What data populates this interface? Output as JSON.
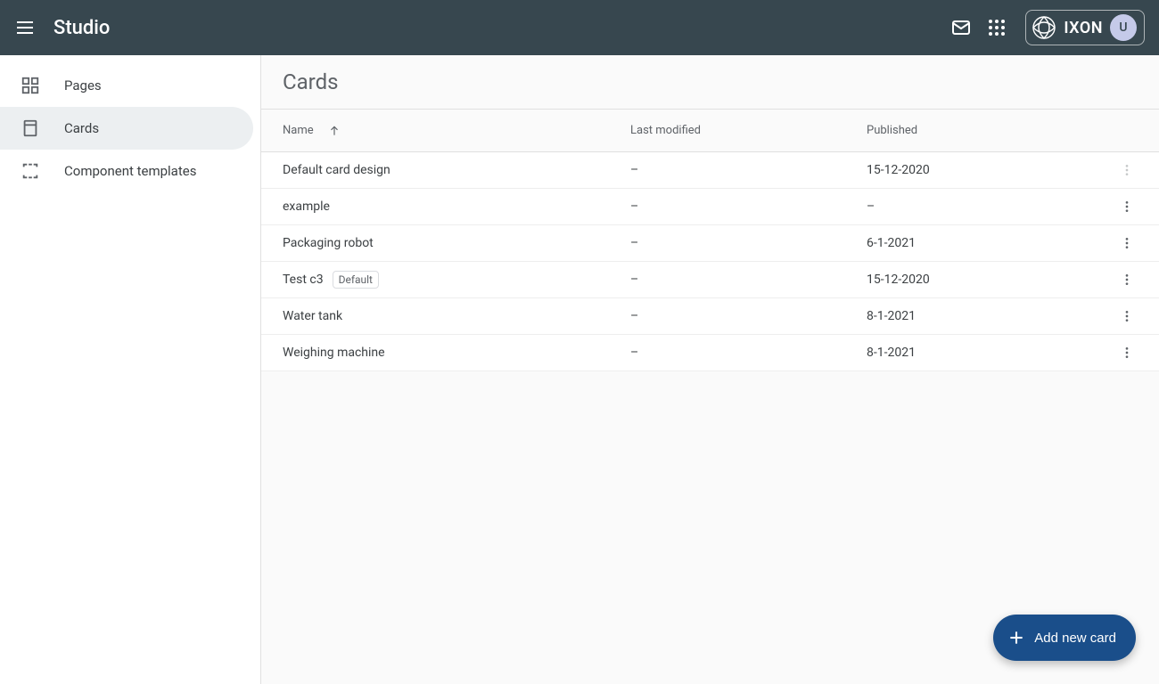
{
  "header": {
    "title": "Studio",
    "brand": "IXON",
    "avatar_initial": "U"
  },
  "sidebar": {
    "items": [
      {
        "label": "Pages",
        "icon": "dashboard",
        "active": false
      },
      {
        "label": "Cards",
        "icon": "card",
        "active": true
      },
      {
        "label": "Component templates",
        "icon": "template",
        "active": false
      }
    ]
  },
  "main": {
    "title": "Cards",
    "columns": {
      "name": "Name",
      "modified": "Last modified",
      "published": "Published"
    },
    "rows": [
      {
        "name": "Default card design",
        "modified": "–",
        "published": "15-12-2020",
        "faded_kebab": true
      },
      {
        "name": "example",
        "modified": "–",
        "published": "–"
      },
      {
        "name": "Packaging robot",
        "modified": "–",
        "published": "6-1-2021"
      },
      {
        "name": "Test c3",
        "modified": "–",
        "published": "15-12-2020",
        "badge": "Default"
      },
      {
        "name": "Water tank",
        "modified": "–",
        "published": "8-1-2021"
      },
      {
        "name": "Weighing machine",
        "modified": "–",
        "published": "8-1-2021"
      }
    ],
    "fab_label": "Add new card"
  }
}
